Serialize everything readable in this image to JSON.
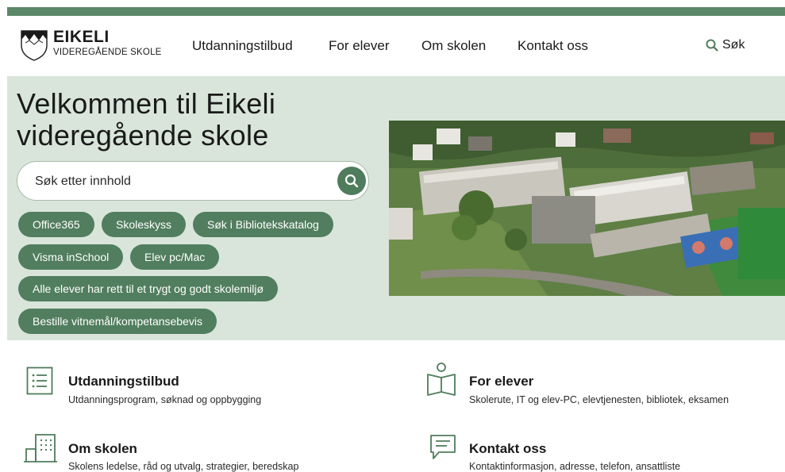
{
  "header": {
    "logo_name": "EIKELI",
    "logo_subtitle": "VIDEREGÅENDE SKOLE",
    "nav": [
      {
        "label": "Utdanningstilbud"
      },
      {
        "label": "For elever"
      },
      {
        "label": "Om skolen"
      },
      {
        "label": "Kontakt oss"
      }
    ],
    "search_label": "Søk"
  },
  "hero": {
    "title": "Velkommen til Eikeli videregående skole",
    "search_placeholder": "Søk etter innhold",
    "quicklinks": [
      {
        "label": "Office365"
      },
      {
        "label": "Skoleskyss"
      },
      {
        "label": "Søk i Bibliotekskatalog"
      },
      {
        "label": "Visma inSchool"
      },
      {
        "label": "Elev pc/Mac"
      },
      {
        "label": "Alle elever har rett til et trygt og godt skolemiljø"
      },
      {
        "label": "Bestille vitnemål/kompetansebevis"
      }
    ]
  },
  "cards": [
    {
      "title": "Utdanningstilbud",
      "description": "Utdanningsprogram, søknad og oppbygging",
      "icon": "list-document-icon"
    },
    {
      "title": "For elever",
      "description": "Skolerute, IT og elev-PC, elevtjenesten, bibliotek, eksamen",
      "icon": "reading-person-icon"
    },
    {
      "title": "Om skolen",
      "description": "Skolens ledelse, råd og utvalg, strategier, beredskap",
      "icon": "building-icon"
    },
    {
      "title": "Kontakt oss",
      "description": "Kontaktinformasjon, adresse, telefon, ansattliste",
      "icon": "chat-bubble-icon"
    }
  ],
  "colors": {
    "brand_green": "#517e5e",
    "hero_background": "#d9e5da",
    "top_bar": "#5b8868"
  }
}
